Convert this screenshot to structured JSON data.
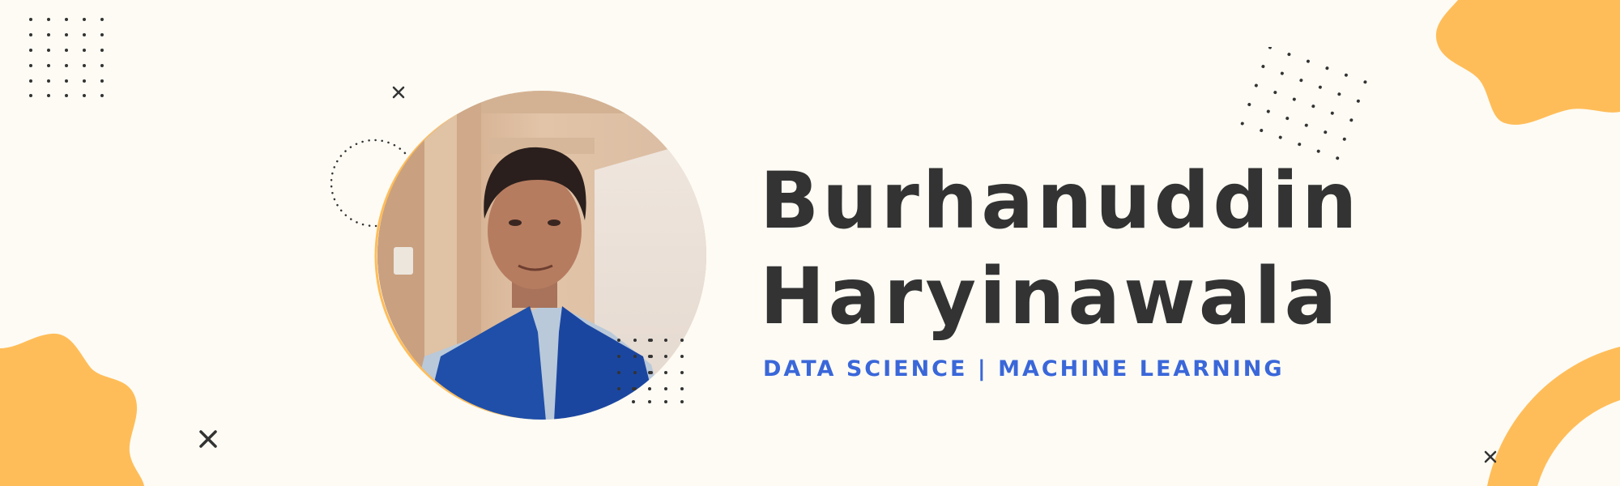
{
  "profile": {
    "first_name": "Burhanuddin",
    "last_name": "Haryinawala",
    "tagline": "DATA SCIENCE | MACHINE LEARNING"
  },
  "colors": {
    "background": "#fdfbf4",
    "accent_blob": "#ffbd59",
    "name_text": "#333333",
    "tagline_text": "#3a67d9",
    "ink": "#333333"
  },
  "decorations": {
    "cross_icon": "cross-icon",
    "dot_grid": "dot-grid-pattern",
    "dotted_ring": "dotted-circle-ring"
  }
}
